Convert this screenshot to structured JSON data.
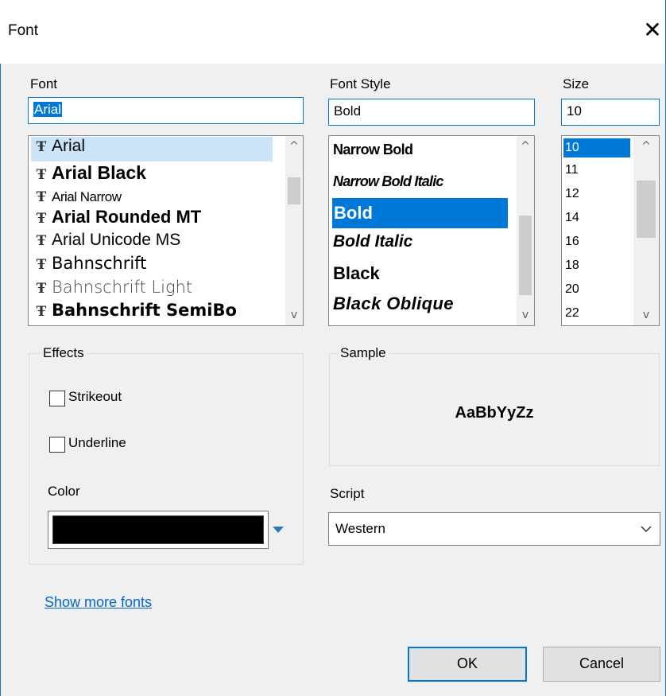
{
  "dialog": {
    "title": "Font",
    "close_glyph": "✕"
  },
  "font": {
    "label": "Font",
    "value": "Arial",
    "items": [
      "Arial",
      "Arial Black",
      "Arial Narrow",
      "Arial Rounded MT",
      "Arial Unicode MS",
      "Bahnschrift",
      "Bahnschrift Light",
      "Bahnschrift SemiBo"
    ],
    "selected": "Arial"
  },
  "font_style": {
    "label": "Font Style",
    "value": "Bold",
    "items": [
      "Narrow Bold",
      "Narrow Bold Italic",
      "Bold",
      "Bold Italic",
      "Black",
      "Black Oblique"
    ],
    "selected": "Bold"
  },
  "size": {
    "label": "Size",
    "value": "10",
    "items": [
      "10",
      "11",
      "12",
      "14",
      "16",
      "18",
      "20",
      "22"
    ],
    "selected": "10"
  },
  "effects": {
    "label": "Effects",
    "strikeout_label": "Strikeout",
    "strikeout_checked": false,
    "underline_label": "Underline",
    "underline_checked": false,
    "color_label": "Color",
    "color_value": "#000000"
  },
  "sample": {
    "label": "Sample",
    "text": "AaBbYyZz"
  },
  "script": {
    "label": "Script",
    "value": "Western"
  },
  "show_more_fonts": "Show more fonts",
  "buttons": {
    "ok": "OK",
    "cancel": "Cancel"
  },
  "icons": {
    "font_type_icon": "Ŧ",
    "chevron_up": "^",
    "chevron_down": "v"
  },
  "colors": {
    "accent": "#0078d7",
    "selection": "#0078d7",
    "selection_inactive": "#cce4f7",
    "link": "#0066cc"
  }
}
